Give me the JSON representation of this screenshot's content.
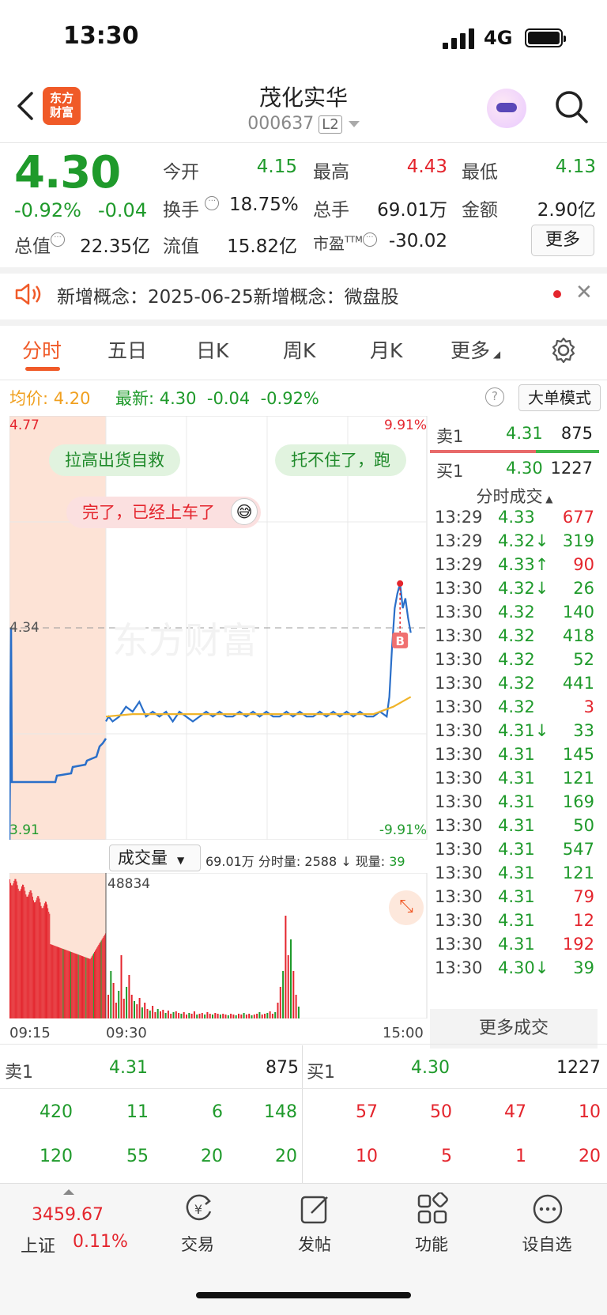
{
  "status": {
    "time": "13:30",
    "network": "4G"
  },
  "header": {
    "logo_text_1": "东方",
    "logo_text_2": "财富",
    "stock_name": "茂化实华",
    "stock_code": "000637",
    "level": "L2"
  },
  "quote": {
    "price": "4.30",
    "change_pct": "-0.92%",
    "change": "-0.04",
    "open_label": "今开",
    "open": "4.15",
    "high_label": "最高",
    "high": "4.43",
    "low_label": "最低",
    "low": "4.13",
    "turnover_label": "换手",
    "turnover": "18.75%",
    "volume_label": "总手",
    "volume": "69.01万",
    "amount_label": "金额",
    "amount": "2.90亿",
    "mktcap_label": "总值",
    "mktcap": "22.35亿",
    "float_label": "流值",
    "float_cap": "15.82亿",
    "pe_label": "市盈",
    "pe_sup": "TTM",
    "pe": "-30.02",
    "more_label": "更多"
  },
  "notice": {
    "text": "新增概念：2025-06-25新增概念：微盘股"
  },
  "tabs": [
    "分时",
    "五日",
    "日K",
    "周K",
    "月K",
    "更多"
  ],
  "chart_header": {
    "avg_label": "均价:",
    "avg": "4.20",
    "latest_label": "最新:",
    "latest": "4.30",
    "latest_chg": "-0.04",
    "latest_pct": "-0.92%",
    "mode_button": "大单模式"
  },
  "chart": {
    "y_top": "4.77",
    "y_mid": "4.34",
    "y_bottom": "3.91",
    "pct_top": "9.91%",
    "pct_bottom": "-9.91%",
    "bubble1": "拉高出货自救",
    "bubble2": "托不住了，跑",
    "bubble3": "完了，已经上车了",
    "buy_marker": "B",
    "watermark": "东方财富"
  },
  "chart_data": {
    "type": "line",
    "title": "",
    "x_ticks": [
      "09:15",
      "09:30",
      "15:00"
    ],
    "ylim": [
      3.91,
      4.77
    ],
    "ref_price": 4.34,
    "series": [
      {
        "x": [
          0,
          2,
          5,
          10,
          15,
          20,
          25,
          30,
          35,
          40,
          45,
          50,
          55,
          60,
          65,
          70,
          75,
          80,
          85,
          90,
          95,
          100,
          105,
          110,
          115,
          120,
          125,
          130,
          135,
          140,
          145,
          150,
          155,
          160,
          165,
          170,
          175,
          180,
          185,
          190,
          195,
          200,
          205,
          210,
          212,
          214,
          216,
          218,
          220,
          222,
          224,
          226,
          228
        ],
        "y": [
          4.15,
          4.16,
          4.15,
          4.16,
          4.18,
          4.17,
          4.19,
          4.16,
          4.17,
          4.16,
          4.17,
          4.15,
          4.17,
          4.16,
          4.15,
          4.16,
          4.17,
          4.16,
          4.17,
          4.16,
          4.16,
          4.17,
          4.16,
          4.17,
          4.16,
          4.17,
          4.16,
          4.16,
          4.17,
          4.16,
          4.17,
          4.16,
          4.16,
          4.17,
          4.16,
          4.17,
          4.16,
          4.17,
          4.16,
          4.17,
          4.16,
          4.16,
          4.17,
          4.16,
          4.2,
          4.3,
          4.38,
          4.41,
          4.43,
          4.38,
          4.4,
          4.36,
          4.33
        ]
      },
      {
        "x": [
          0,
          20,
          40,
          60,
          80,
          100,
          120,
          140,
          160,
          180,
          200,
          215,
          228
        ],
        "y": [
          4.16,
          4.165,
          4.165,
          4.165,
          4.165,
          4.165,
          4.165,
          4.165,
          4.165,
          4.165,
          4.165,
          4.18,
          4.2
        ]
      }
    ]
  },
  "volume": {
    "selector_label": "成交量",
    "total": "69.01万",
    "minute_label": "分时量:",
    "minute": "2588",
    "now_label": "现量:",
    "now": "39",
    "max": "48834",
    "time_start": "09:15",
    "time_open": "09:30",
    "time_end": "15:00"
  },
  "right_panel": {
    "sell1_label": "卖1",
    "sell1_price": "4.31",
    "sell1_vol": "875",
    "buy1_label": "买1",
    "buy1_price": "4.30",
    "buy1_vol": "1227",
    "trades_title": "分时成交",
    "trades": [
      {
        "t": "13:29",
        "p": "4.33",
        "v": "677",
        "pc": "green",
        "vc": "red",
        "arrow": ""
      },
      {
        "t": "13:29",
        "p": "4.32↓",
        "v": "319",
        "pc": "green",
        "vc": "green",
        "arrow": "down"
      },
      {
        "t": "13:29",
        "p": "4.33↑",
        "v": "90",
        "pc": "green",
        "vc": "red",
        "arrow": "up"
      },
      {
        "t": "13:30",
        "p": "4.32↓",
        "v": "26",
        "pc": "green",
        "vc": "green",
        "arrow": "down"
      },
      {
        "t": "13:30",
        "p": "4.32",
        "v": "140",
        "pc": "green",
        "vc": "green",
        "arrow": ""
      },
      {
        "t": "13:30",
        "p": "4.32",
        "v": "418",
        "pc": "green",
        "vc": "green",
        "arrow": ""
      },
      {
        "t": "13:30",
        "p": "4.32",
        "v": "52",
        "pc": "green",
        "vc": "green",
        "arrow": ""
      },
      {
        "t": "13:30",
        "p": "4.32",
        "v": "441",
        "pc": "green",
        "vc": "green",
        "arrow": ""
      },
      {
        "t": "13:30",
        "p": "4.32",
        "v": "3",
        "pc": "green",
        "vc": "red",
        "arrow": ""
      },
      {
        "t": "13:30",
        "p": "4.31↓",
        "v": "33",
        "pc": "green",
        "vc": "green",
        "arrow": "down"
      },
      {
        "t": "13:30",
        "p": "4.31",
        "v": "145",
        "pc": "green",
        "vc": "green",
        "arrow": ""
      },
      {
        "t": "13:30",
        "p": "4.31",
        "v": "121",
        "pc": "green",
        "vc": "green",
        "arrow": ""
      },
      {
        "t": "13:30",
        "p": "4.31",
        "v": "169",
        "pc": "green",
        "vc": "green",
        "arrow": ""
      },
      {
        "t": "13:30",
        "p": "4.31",
        "v": "50",
        "pc": "green",
        "vc": "green",
        "arrow": ""
      },
      {
        "t": "13:30",
        "p": "4.31",
        "v": "547",
        "pc": "green",
        "vc": "green",
        "arrow": ""
      },
      {
        "t": "13:30",
        "p": "4.31",
        "v": "121",
        "pc": "green",
        "vc": "green",
        "arrow": ""
      },
      {
        "t": "13:30",
        "p": "4.31",
        "v": "79",
        "pc": "green",
        "vc": "red",
        "arrow": ""
      },
      {
        "t": "13:30",
        "p": "4.31",
        "v": "12",
        "pc": "green",
        "vc": "red",
        "arrow": ""
      },
      {
        "t": "13:30",
        "p": "4.31",
        "v": "192",
        "pc": "green",
        "vc": "red",
        "arrow": ""
      },
      {
        "t": "13:30",
        "p": "4.30↓",
        "v": "39",
        "pc": "green",
        "vc": "green",
        "arrow": "down"
      }
    ],
    "more_trades": "更多成交"
  },
  "order_book": {
    "sell_label": "卖1",
    "sell_price": "4.31",
    "sell_vol": "875",
    "buy_label": "买1",
    "buy_price": "4.30",
    "buy_vol": "1227",
    "sell_row1": [
      "420",
      "11",
      "6",
      "148"
    ],
    "sell_row2": [
      "120",
      "55",
      "20",
      "20"
    ],
    "buy_row1": [
      "57",
      "50",
      "47",
      "10"
    ],
    "buy_row2": [
      "10",
      "5",
      "1",
      "20"
    ]
  },
  "bottom_nav": {
    "index_value": "3459.67",
    "index_name": "上证",
    "index_pct": "0.11%",
    "items": [
      "交易",
      "发帖",
      "功能",
      "设自选"
    ]
  },
  "colors": {
    "up": "#e4252d",
    "down": "#1f9a2b",
    "accent": "#f05a28"
  }
}
